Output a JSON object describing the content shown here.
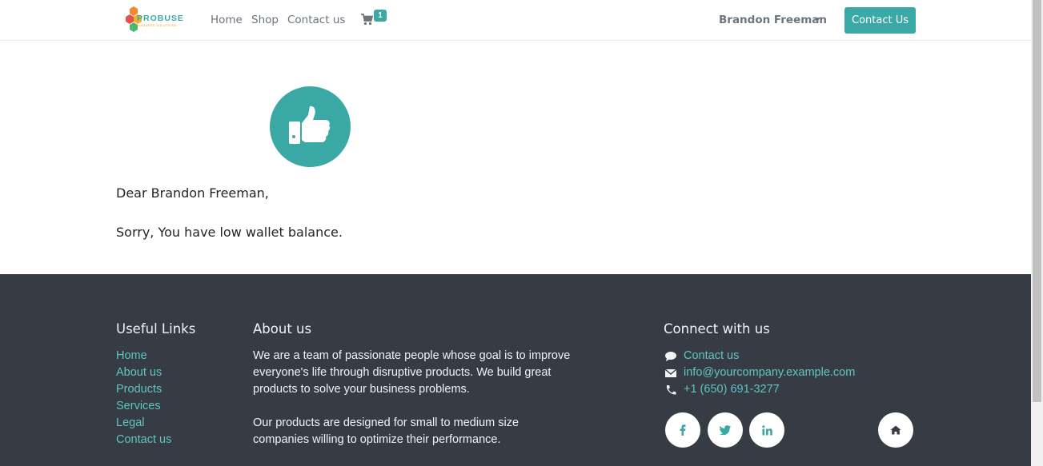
{
  "header": {
    "brand_name": "PROBUSE",
    "brand_tagline": "BUSINESS SOLUTIONS",
    "nav": [
      "Home",
      "Shop",
      "Contact us"
    ],
    "cart_count": "1",
    "user_name": "Brandon Freeman",
    "contact_button": "Contact Us"
  },
  "main": {
    "greeting": "Dear Brandon Freeman,",
    "message": "Sorry, You have low wallet balance.",
    "icon": "thumbs-up-icon"
  },
  "footer": {
    "useful_links_title": "Useful Links",
    "useful_links": [
      "Home",
      "About us",
      "Products",
      "Services",
      "Legal",
      "Contact us"
    ],
    "about_title": "About us",
    "about_lines": [
      "We are a team of passionate people whose goal is to improve",
      "everyone's life through disruptive products. We build great",
      "products to solve your business problems.",
      "Our products are designed for small to medium size",
      "companies willing to optimize their performance."
    ],
    "connect_title": "Connect with us",
    "contact_link": "Contact us",
    "email": "info@yourcompany.example.com",
    "phone": "+1 (650) 691-3277",
    "social_icons": [
      "facebook-icon",
      "twitter-icon",
      "linkedin-icon",
      "home-icon"
    ]
  },
  "colors": {
    "accent": "#3aa9a6",
    "footer_bg": "#363b44",
    "link": "#5fc6c2"
  }
}
